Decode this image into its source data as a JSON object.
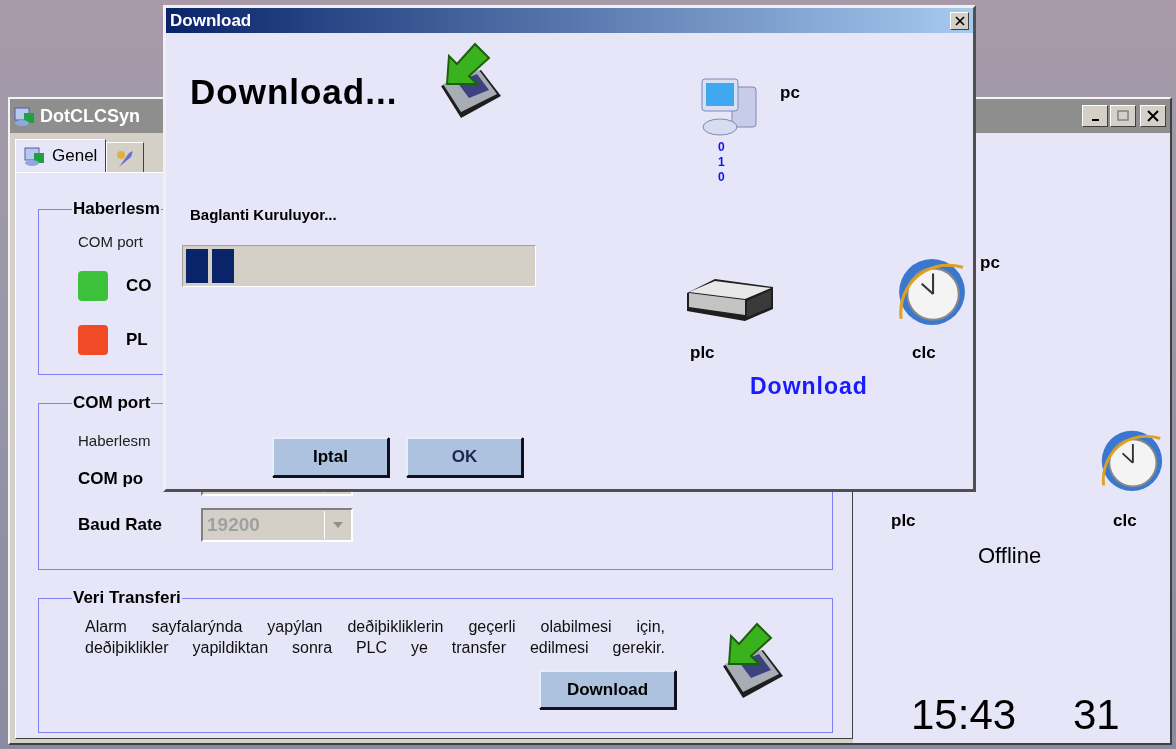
{
  "main_window": {
    "title": "DotCLCSyn",
    "tabs": [
      {
        "label": "Genel",
        "selected": true
      },
      {
        "selected": false
      }
    ],
    "groups": [
      {
        "title": "Haberlesm",
        "items": [
          {
            "kind": "text",
            "label": "COM port"
          },
          {
            "kind": "status",
            "label": "CO",
            "color": "#3cc23a"
          },
          {
            "kind": "status",
            "label": "PL",
            "color": "#f04a26"
          }
        ]
      },
      {
        "title": "COM port",
        "items": [
          {
            "kind": "text",
            "label": "Haberlesm"
          },
          {
            "kind": "select",
            "label": "COM po",
            "disabled": true
          },
          {
            "kind": "select",
            "label": "Baud Rate",
            "value": "19200",
            "disabled": true
          }
        ]
      },
      {
        "title": "Veri Transferi",
        "items": [
          {
            "kind": "paragraph",
            "text": "Alarm sayfalarýnda yapýlan deðiþikliklerin geçerli olabilmesi için,\ndeðiþiklikler yapildiktan sonra PLC ye transfer edilmesi gerekir."
          },
          {
            "kind": "button",
            "label": "Download"
          }
        ]
      }
    ],
    "status_panel": {
      "nodes": [
        {
          "kind": "pc",
          "label": "pc"
        },
        {
          "kind": "plc",
          "label": "plc"
        },
        {
          "kind": "clc",
          "label": "clc"
        }
      ],
      "state": "Offline",
      "time": "15:43",
      "seconds": "31"
    }
  },
  "dialog": {
    "title": "Download",
    "heading": "Download...",
    "message": "Baglanti Kuruluyor...",
    "progress": {
      "level": 0.15
    },
    "nodes": [
      {
        "kind": "pc",
        "label": "pc",
        "bits": [
          "0",
          "1",
          "0"
        ]
      },
      {
        "kind": "plc",
        "label": "plc"
      },
      {
        "kind": "clc",
        "label": "clc"
      }
    ],
    "action": "Download",
    "buttons": [
      {
        "label": "Iptal"
      },
      {
        "label": "OK"
      }
    ]
  }
}
